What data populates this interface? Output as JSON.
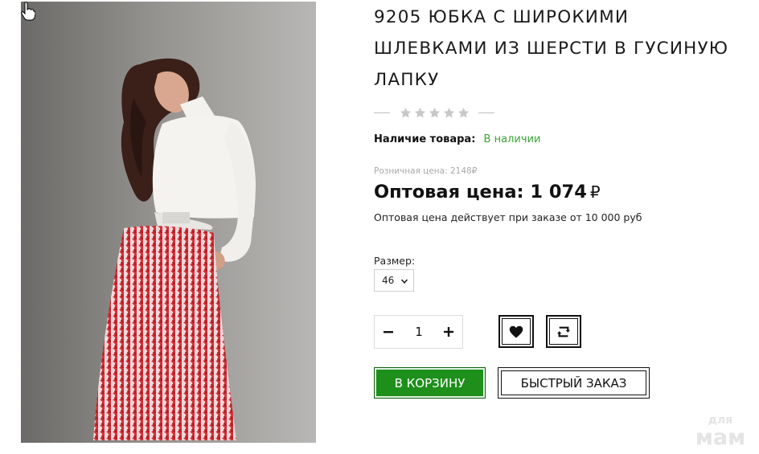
{
  "product": {
    "image_alt": "Модель в белой водолазке и красной юбке в гусиную лапку",
    "title": "9205 ЮБКА С ШИРОКИМИ ШЛЕВКАМИ ИЗ ШЕРСТИ В ГУСИНУЮ ЛАПКУ",
    "rating": {
      "value": 0,
      "max": 5
    },
    "availability": {
      "label": "Наличие товара:",
      "value": "В наличии"
    },
    "retail_price": "Розничная цена: 2148₽",
    "wholesale_price": {
      "label": "Оптовая цена:",
      "amount": "1 074",
      "currency": "₽"
    },
    "wholesale_note": "Оптовая цена действует при заказе от 10 000 руб",
    "size": {
      "label": "Размер:",
      "selected": "46"
    },
    "quantity": {
      "minus": "−",
      "value": "1",
      "plus": "+"
    },
    "buttons": {
      "cart": "В КОРЗИНУ",
      "quick_order": "БЫСТРЫЙ ЗАКАЗ"
    },
    "icons": {
      "wishlist": "heart-icon",
      "compare": "compare-arrows-icon",
      "cursor": "hand-cursor-icon"
    }
  },
  "watermark": {
    "line1": "для",
    "line2": "мам"
  },
  "colors": {
    "accent_green": "#1d8f1a",
    "in_stock_green": "#3aa335",
    "star_gray": "#c8c8c8",
    "text": "#111111"
  }
}
